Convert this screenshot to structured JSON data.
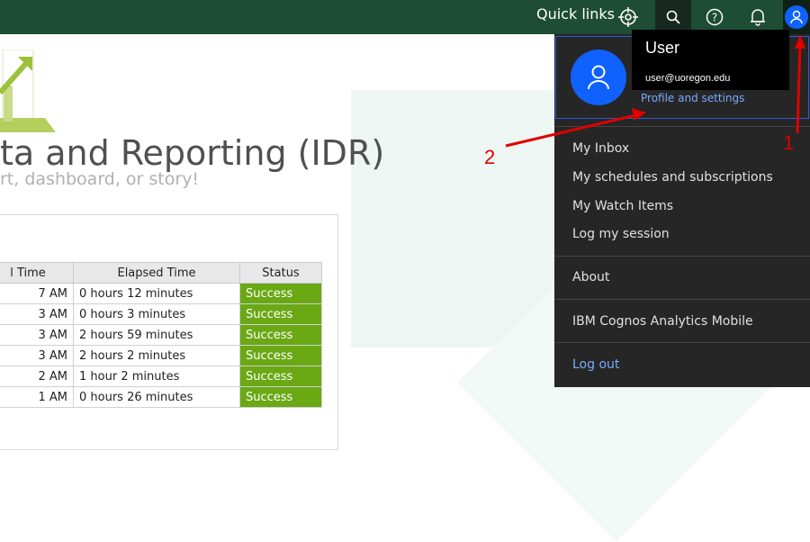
{
  "topbar": {
    "quick_links": "Quick links"
  },
  "page": {
    "title": "ta and Reporting (IDR)",
    "subtitle": "rt, dashboard, or story!"
  },
  "table": {
    "headers": [
      "l Time",
      "Elapsed Time",
      "Status"
    ],
    "rows": [
      [
        "7 AM",
        "0 hours 12 minutes",
        "Success"
      ],
      [
        "3 AM",
        "0 hours 3 minutes",
        "Success"
      ],
      [
        "3 AM",
        "2 hours 59 minutes",
        "Success"
      ],
      [
        "3 AM",
        "2 hours 2 minutes",
        "Success"
      ],
      [
        "2 AM",
        "1 hour 2 minutes",
        "Success"
      ],
      [
        "1 AM",
        "0 hours 26 minutes",
        "Success"
      ]
    ]
  },
  "user_menu": {
    "name": "User",
    "email": "user@uoregon.edu",
    "profile_link": "Profile and settings",
    "items": [
      "My Inbox",
      "My schedules and subscriptions",
      "My Watch Items",
      "Log my session"
    ],
    "about": "About",
    "mobile": "IBM Cognos Analytics Mobile",
    "logout": "Log out"
  },
  "annotations": {
    "one": "1",
    "two": "2"
  },
  "colors": {
    "topbar": "#1e4d35",
    "accent": "#0f62fe",
    "success": "#6aa814",
    "annotation": "#e00000"
  },
  "icons": [
    "target-icon",
    "search-icon",
    "help-icon",
    "bell-icon",
    "user-icon"
  ]
}
